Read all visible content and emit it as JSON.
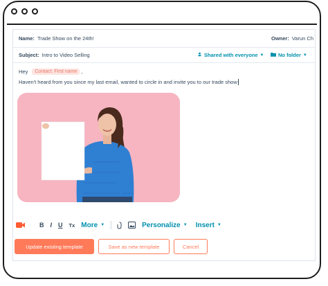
{
  "email": {
    "name_label": "Name:",
    "name_value": "Trade Show on the 24th!",
    "owner_label": "Owner:",
    "owner_value": "Varun Ch",
    "subject_label": "Subject:",
    "subject_value": "Intro to Video Selling",
    "shared_label": "Shared with everyone",
    "folder_label": "No folder",
    "greeting": "Hey",
    "token_label": "Contact: First name",
    "token_suffix": ",",
    "message": "Haven't heard from you since my last email, wanted to circle in and invite you to our trade show"
  },
  "toolbar": {
    "bold": "B",
    "italic": "I",
    "underline": "U",
    "clear_format": "Tx",
    "more_label": "More",
    "personalize_label": "Personalize",
    "insert_label": "Insert"
  },
  "buttons": {
    "update_label": "Update existing template",
    "save_new_label": "Save as new template",
    "cancel_label": "Cancel"
  },
  "colors": {
    "accent": "#ff7a59",
    "link": "#0091ae",
    "text": "#33475b",
    "photo_bg": "#f6b5c1",
    "sweater": "#2f7fd3"
  },
  "icons": {
    "video": "video-camera-icon",
    "attach": "paperclip-icon",
    "image": "image-icon"
  }
}
